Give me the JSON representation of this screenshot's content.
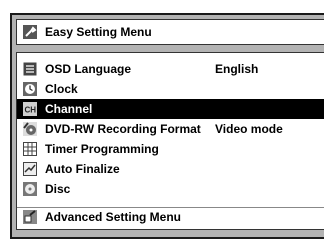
{
  "title": {
    "label": "Easy Setting Menu",
    "icon": "wrench-icon"
  },
  "menu": {
    "items": [
      {
        "label": "OSD Language",
        "value": "English",
        "icon": "document-icon"
      },
      {
        "label": "Clock",
        "value": "",
        "icon": "clock-icon"
      },
      {
        "label": "Channel",
        "value": "",
        "icon": "channel-icon",
        "selected": true
      },
      {
        "label": "DVD-RW Recording Format",
        "value": "Video mode",
        "icon": "disc-recording-icon"
      },
      {
        "label": "Timer Programming",
        "value": "",
        "icon": "grid-icon"
      },
      {
        "label": "Auto Finalize",
        "value": "",
        "icon": "finalize-icon"
      },
      {
        "label": "Disc",
        "value": "",
        "icon": "disc-icon"
      }
    ],
    "advanced": {
      "label": "Advanced Setting Menu",
      "icon": "advanced-settings-icon"
    }
  },
  "colors": {
    "frame": "#b3b3b3",
    "selected_row": "#000000"
  }
}
